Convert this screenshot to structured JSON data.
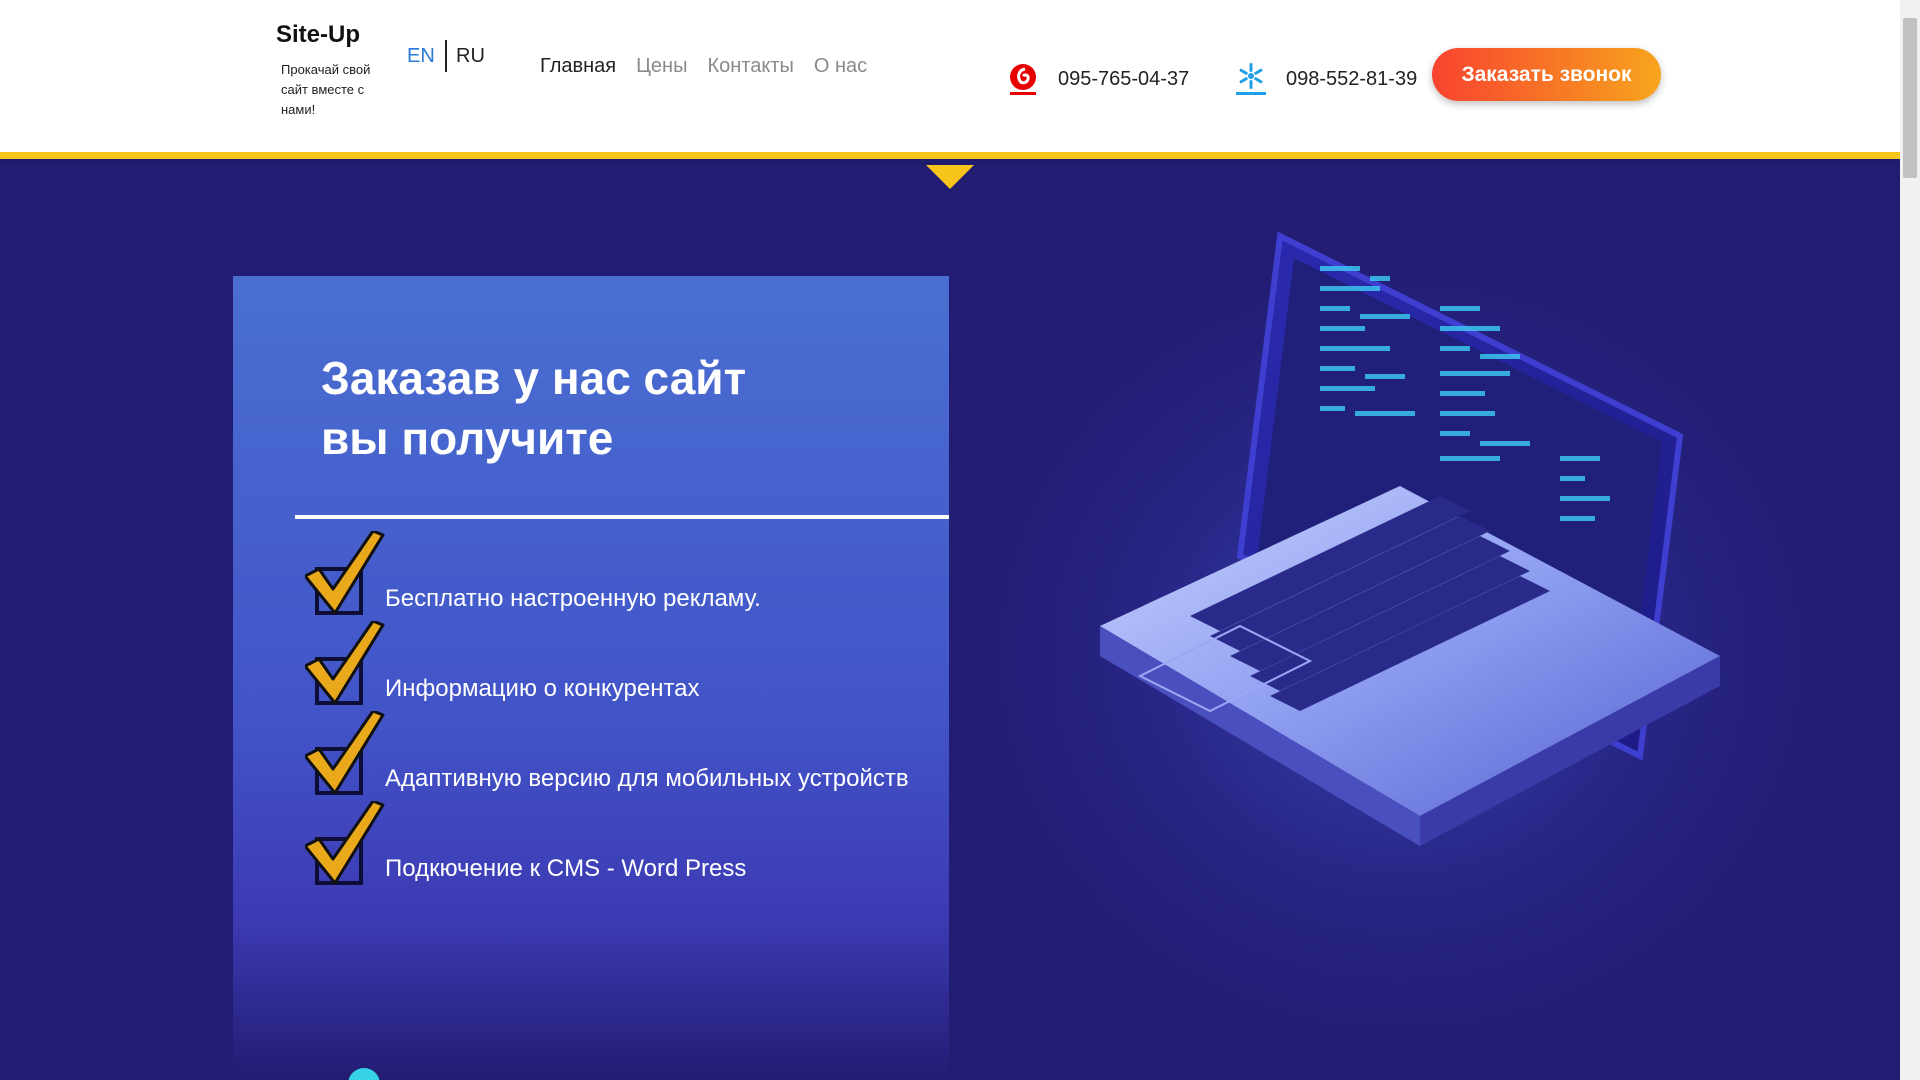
{
  "header": {
    "logo_title": "Site-Up",
    "logo_tagline": "Прокачай свой сайт вместе с нами!",
    "lang": {
      "en": "EN",
      "ru": "RU",
      "active": "en"
    },
    "nav": [
      {
        "label": "Главная",
        "active": true
      },
      {
        "label": "Цены",
        "active": false
      },
      {
        "label": "Контакты",
        "active": false
      },
      {
        "label": "О нас",
        "active": false
      }
    ],
    "phones": [
      {
        "number": "095-765-04-37",
        "operator_icon": "vodafone-icon"
      },
      {
        "number": "098-552-81-39",
        "operator_icon": "kyivstar-icon"
      }
    ],
    "call_button": "Заказать звонок"
  },
  "hero": {
    "title_line1": "Заказав у нас сайт",
    "title_line2": "вы получите",
    "benefits": [
      "Бесплатно настроенную рекламу.",
      "Информацию о конкурентах",
      "Адаптивную версию для мобильных устройств",
      "Подкючение к CMS - Word Press"
    ]
  },
  "colors": {
    "accent_yellow": "#f7c51a",
    "hero_bg": "#221c72",
    "card_blue": "#4a6fd1",
    "button_orange": "#f8432f",
    "link_blue": "#2a7ad8"
  }
}
